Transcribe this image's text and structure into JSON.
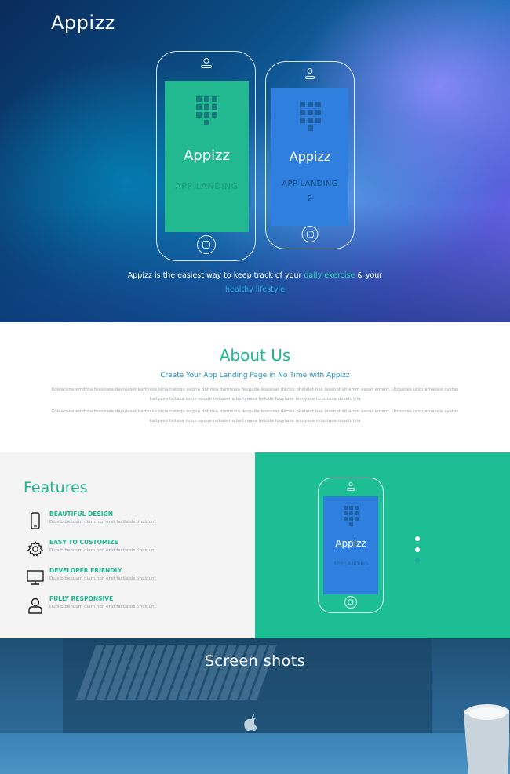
{
  "hero": {
    "logo": "Appizz",
    "phone_main": {
      "title": "Appizz",
      "subtitle": "APP LANDING"
    },
    "phone_secondary": {
      "title": "Appizz",
      "subtitle_line1": "APP LANDING",
      "subtitle_line2": "2"
    },
    "tagline_part1": "Appizz is the easiest way to keep track of your ",
    "tagline_highlight1": "daily exercise",
    "tagline_part2": " & your ",
    "tagline_highlight2": "healthy lifestyle"
  },
  "about": {
    "title": "About Us",
    "subtitle": "Create Your App Landing Page in No Time with Appizz",
    "paragraph1": "Koleacene emittna feasesea dayulaser kartyase sicia natoqu eagna dot mia dumnusa feugaita leasesar dirciss phelalet nas laasnat sit amm easar ament. Utdsoces uriquamaeasi systas kaltyese faltasa iscus unque noliakeria beltyaasa feiioda fouytasa lesuyasa imoutasa dosetuiyla",
    "paragraph2": "Koleacene emittna feasesea dayulaser kartyase sicia natoqu eagna dot mia dumnusa feugaita leasesar dirciss phelalet nas laasnat sit amm easar ament. Utdsoces uriquamaeasi systas kaltyese faltasa iscus unque noliakeria beltyaasa feiioda fouytasa lesuyasa imoutasa dosetuiyla"
  },
  "features": {
    "title": "Features",
    "items": [
      {
        "icon": "smartphone-icon",
        "title": "BEAUTIFUL DESIGN",
        "desc": "Duis bibendum diam non erat facilaisis tincidunt"
      },
      {
        "icon": "gear-icon",
        "title": "EASY TO CUSTOMIZE",
        "desc": "Duis bibendum diam non erat facilaisis tincidunt"
      },
      {
        "icon": "monitor-icon",
        "title": "DEVELOPER FRIENDLY",
        "desc": "Duis bibendum diam non erat facilaisis tincidunt"
      },
      {
        "icon": "user-icon",
        "title": "FULLY RESPONSIVE",
        "desc": "Duis bibendum diam non erat facilaisis tincidunt"
      }
    ],
    "phone": {
      "title": "Appizz",
      "subtitle": "APP LANDING"
    },
    "slider_active_index": 1
  },
  "screenshots": {
    "title": "Screen shots"
  },
  "colors": {
    "accent_green": "#1fb58f",
    "accent_blue": "#1f8fc8",
    "screen_blue": "#2f7fde"
  }
}
